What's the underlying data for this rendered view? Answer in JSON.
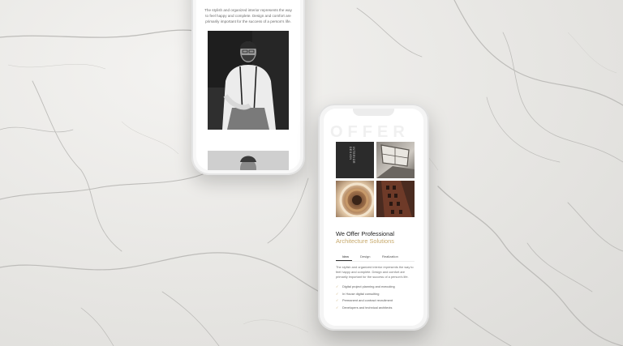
{
  "phone_left": {
    "intro_text": "The stylish and organized interior represents the way to feel happy and complete. Design and comfort are primarily important for the success of a person's life."
  },
  "phone_right": {
    "background_word": "OFFER",
    "vertical_label": "INTERIOR DESIGN",
    "heading_line1": "We Offer Professional",
    "heading_line2": "Architecture Solutions",
    "tabs": [
      {
        "label": "Idea"
      },
      {
        "label": "Design"
      },
      {
        "label": "Realization"
      }
    ],
    "body_text": "The stylish and organized interior represents the way to feel happy and complete. Design and comfort are primarily important for the success of a person's life.",
    "features": [
      {
        "label": "Digital project planning and executing"
      },
      {
        "label": "In House digital consulting"
      },
      {
        "label": "Permanent and contract recruitment"
      },
      {
        "label": "Developers and technical architects"
      }
    ]
  },
  "colors": {
    "accent": "#c7a96c",
    "heading": "#222222",
    "text": "#6e6e6e"
  }
}
